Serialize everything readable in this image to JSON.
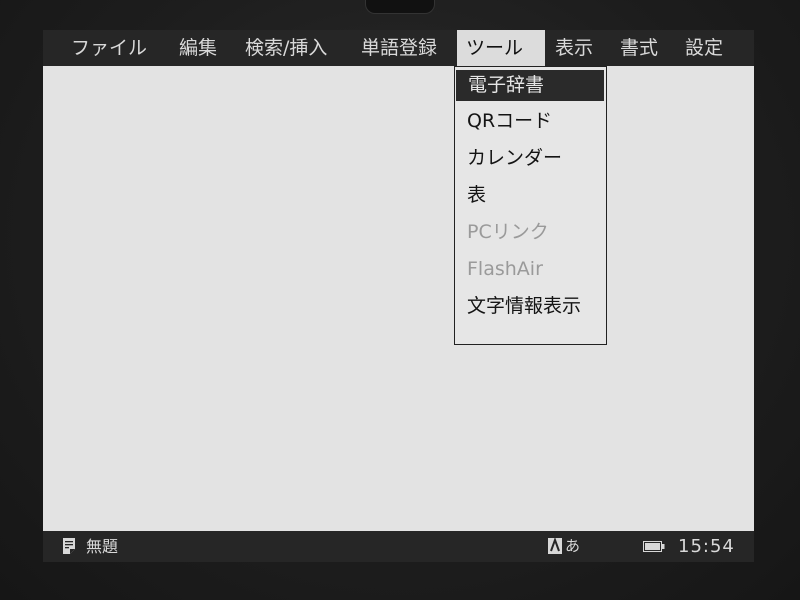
{
  "menubar": {
    "items": [
      {
        "label": "ファイル"
      },
      {
        "label": "編集"
      },
      {
        "label": "検索/挿入"
      },
      {
        "label": "単語登録"
      },
      {
        "label": "ツール"
      },
      {
        "label": "表示"
      },
      {
        "label": "書式"
      },
      {
        "label": "設定"
      }
    ],
    "active_label": "ツール"
  },
  "tools_menu": {
    "items": [
      {
        "label": "電子辞書",
        "state": "selected"
      },
      {
        "label": "QRコード",
        "state": "enabled"
      },
      {
        "label": "カレンダー",
        "state": "enabled"
      },
      {
        "label": "表",
        "state": "enabled"
      },
      {
        "label": "PCリンク",
        "state": "disabled"
      },
      {
        "label": "FlashAir",
        "state": "disabled"
      },
      {
        "label": "文字情報表示",
        "state": "enabled"
      }
    ]
  },
  "statusbar": {
    "doc_icon": "document-icon",
    "doc_title": "無題",
    "ime_icon": "input-mode-icon",
    "ime_mode": "あ",
    "battery_icon": "battery-icon",
    "clock": "15:54"
  },
  "colors": {
    "bar_background": "#262626",
    "screen_background": "#e3e3e3",
    "selected_background": "#2a2a2a",
    "disabled_text": "#9a9a9a"
  }
}
